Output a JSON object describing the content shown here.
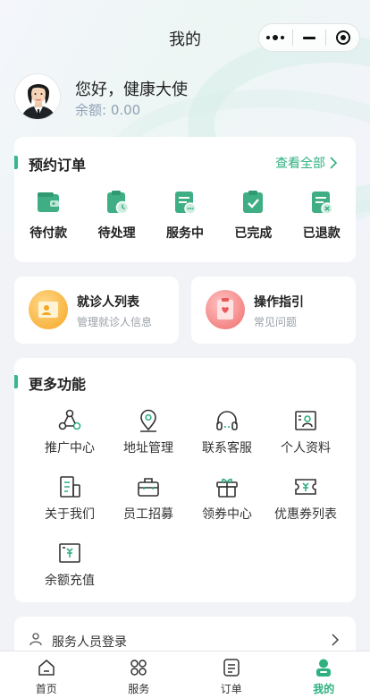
{
  "navbar": {
    "title": "我的"
  },
  "profile": {
    "greeting": "您好，健康大使",
    "balance": "余额: 0.00"
  },
  "orders": {
    "title": "预约订单",
    "view_all": "查看全部",
    "items": [
      {
        "label": "待付款",
        "icon": "wallet-icon"
      },
      {
        "label": "待处理",
        "icon": "clipboard-clock-icon"
      },
      {
        "label": "服务中",
        "icon": "document-dots-icon"
      },
      {
        "label": "已完成",
        "icon": "clipboard-check-icon"
      },
      {
        "label": "已退款",
        "icon": "document-x-icon"
      }
    ]
  },
  "quick": [
    {
      "title": "就诊人列表",
      "subtitle": "管理就诊人信息",
      "icon": "patient-card-icon"
    },
    {
      "title": "操作指引",
      "subtitle": "常见问题",
      "icon": "guide-clipboard-icon"
    }
  ],
  "more": {
    "title": "更多功能",
    "items": [
      {
        "label": "推广中心",
        "icon": "share-icon"
      },
      {
        "label": "地址管理",
        "icon": "location-icon"
      },
      {
        "label": "联系客服",
        "icon": "headset-icon"
      },
      {
        "label": "个人资料",
        "icon": "profile-card-icon"
      },
      {
        "label": "关于我们",
        "icon": "building-doc-icon"
      },
      {
        "label": "员工招募",
        "icon": "briefcase-icon"
      },
      {
        "label": "领券中心",
        "icon": "gift-icon"
      },
      {
        "label": "优惠券列表",
        "icon": "coupon-icon"
      },
      {
        "label": "余额充值",
        "icon": "recharge-icon"
      }
    ]
  },
  "staff_login": {
    "label": "服务人员登录"
  },
  "tabbar": [
    {
      "label": "首页",
      "icon": "home-icon"
    },
    {
      "label": "服务",
      "icon": "services-grid-icon"
    },
    {
      "label": "订单",
      "icon": "orders-doc-icon"
    },
    {
      "label": "我的",
      "icon": "my-profile-icon",
      "active": true
    }
  ],
  "colors": {
    "accent": "#2fb07f",
    "background": "#f1f3f7"
  }
}
